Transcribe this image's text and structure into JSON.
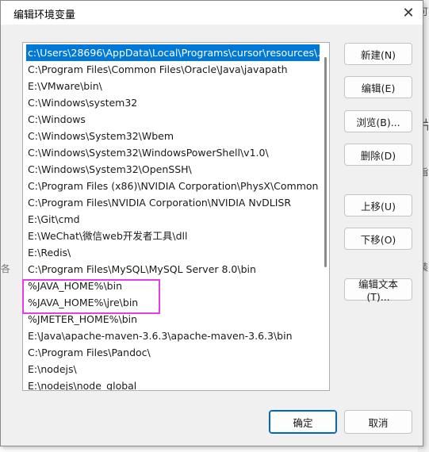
{
  "window": {
    "title": "编辑环境变量"
  },
  "path_list": {
    "items": [
      "c:\\Users\\28696\\AppData\\Local\\Programs\\cursor\\resources\\...",
      "C:\\Program Files\\Common Files\\Oracle\\Java\\javapath",
      "E:\\VMware\\bin\\",
      "C:\\Windows\\system32",
      "C:\\Windows",
      "C:\\Windows\\System32\\Wbem",
      "C:\\Windows\\System32\\WindowsPowerShell\\v1.0\\",
      "C:\\Windows\\System32\\OpenSSH\\",
      "C:\\Program Files (x86)\\NVIDIA Corporation\\PhysX\\Common",
      "C:\\Program Files\\NVIDIA Corporation\\NVIDIA NvDLISR",
      "E:\\Git\\cmd",
      "E:\\WeChat\\微信web开发者工具\\dll",
      "E:\\Redis\\",
      "C:\\Program Files\\MySQL\\MySQL Server 8.0\\bin",
      "%JAVA_HOME%\\bin",
      "%JAVA_HOME%\\jre\\bin",
      "%JMETER_HOME%\\bin",
      "E:\\Java\\apache-maven-3.6.3\\apache-maven-3.6.3\\bin",
      "C:\\Program Files\\Pandoc\\",
      "E:\\nodejs\\",
      "E:\\nodejs\\node_global"
    ],
    "selected_index": 0
  },
  "buttons": {
    "new": "新建(N)",
    "edit": "编辑(E)",
    "browse": "浏览(B)...",
    "delete": "删除(D)",
    "move_up": "上移(U)",
    "move_down": "下移(O)",
    "edit_text": "编辑文本(T)...",
    "ok": "确定",
    "cancel": "取消"
  },
  "background_fragments": [
    "可",
    "片",
    "指",
    "J",
    "装",
    "各"
  ],
  "colors": {
    "selection": "#0078d7",
    "annotation_box": "#e63ee6",
    "ok_border": "#0067c0"
  }
}
